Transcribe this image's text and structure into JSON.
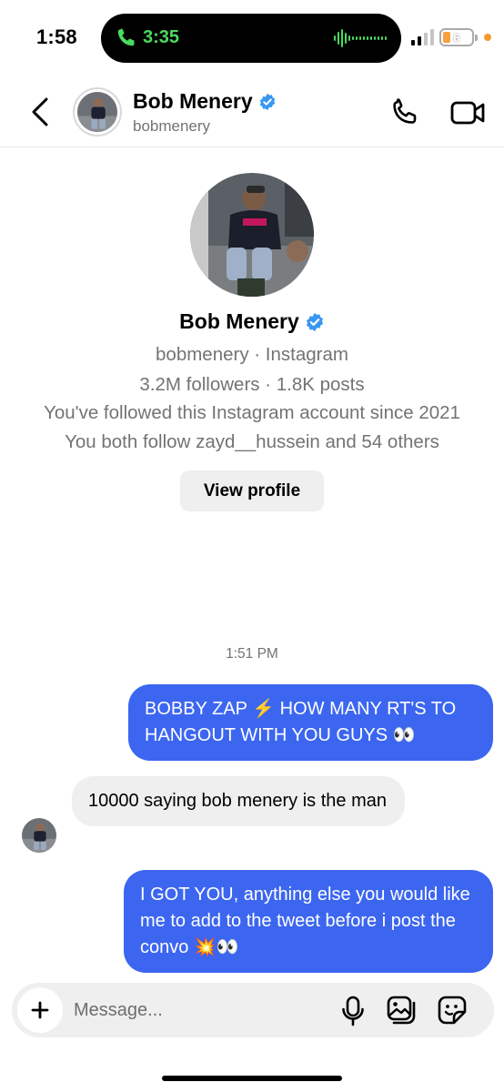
{
  "status_bar": {
    "time": "1:58",
    "call_timer": "3:35",
    "battery_level": "6",
    "battery_color": "#f8a040",
    "call_color": "#4ada5f"
  },
  "header": {
    "back_icon": "chevron-left-icon",
    "name": "Bob Menery",
    "username": "bobmenery",
    "verified_icon": "verified-badge-icon",
    "call_icon": "phone-icon",
    "video_icon": "video-camera-icon"
  },
  "profile": {
    "name": "Bob Menery",
    "source": "bobmenery · Instagram",
    "stats": "3.2M followers · 1.8K posts",
    "follow_since": "You've followed this Instagram account since 2021",
    "mutuals": "You both follow zayd__hussein and 54 others",
    "view_profile_label": "View profile"
  },
  "thread": {
    "timestamp": "1:51 PM",
    "messages": [
      {
        "direction": "outgoing",
        "text": "BOBBY ZAP ⚡️ HOW MANY RT'S TO HANGOUT WITH YOU GUYS 👀"
      },
      {
        "direction": "incoming",
        "text": "10000 saying bob menery is the man"
      },
      {
        "direction": "outgoing",
        "text": "I GOT YOU, anything else you would like me to add to the tweet before i post the convo 💥👀"
      }
    ]
  },
  "composer": {
    "placeholder": "Message...",
    "plus_icon": "plus-icon",
    "mic_icon": "microphone-icon",
    "gallery_icon": "gallery-icon",
    "sticker_icon": "sticker-icon"
  },
  "colors": {
    "outgoing_bubble": "#3c66f0",
    "incoming_bubble": "#efefef",
    "verified_badge": "#3897f0",
    "secondary_text": "#737373"
  }
}
